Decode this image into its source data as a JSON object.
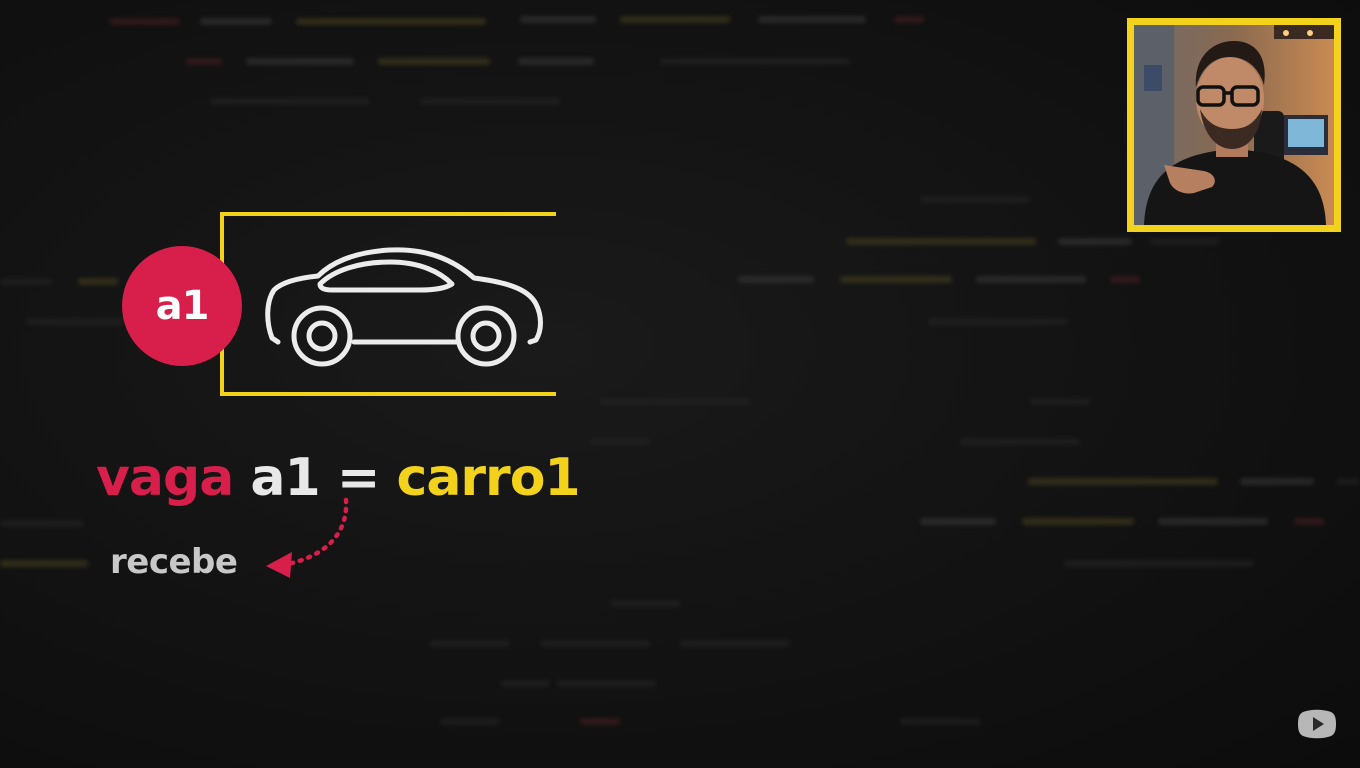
{
  "slot": {
    "badge_label": "a1"
  },
  "expression": {
    "keyword": "vaga",
    "variable": "a1",
    "operator": "=",
    "value": "carro1"
  },
  "annotation": {
    "label": "recebe"
  },
  "icons": {
    "slot_icon": "car-icon",
    "arrow": "dotted-curved-arrow-icon",
    "watermark": "play-button-icon"
  },
  "colors": {
    "accent_red": "#d81e4a",
    "accent_yellow": "#f2d21b",
    "text_white": "#e8e8e8",
    "text_grey": "#c8c8c8",
    "background": "#111111"
  }
}
